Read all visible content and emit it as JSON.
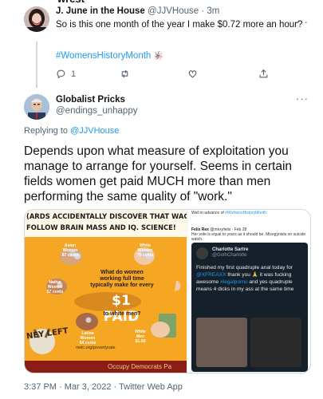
{
  "fragment_top": "wrest",
  "tweet1": {
    "name": "J. June in the House",
    "handle_time": "@JJVHouse · 3m",
    "text": "So is this one month of the year I make $0.72 more an hour?",
    "hashtag": "#WomensHistoryMonth",
    "hashtag_emoji": "🪅",
    "reply_count": "1",
    "more": "···"
  },
  "tweet2": {
    "name": "Globalist Pricks",
    "handle": "@endings_unhappy",
    "replying_prefix": "Replying to ",
    "replying_to": "@JJVHouse",
    "text": "Depends upon what measure of exploitation you manage to arrange for yourself.  Seems in certain fields women get paid MUCH more than men performing the same quality of \"work.\"",
    "more": "···",
    "timestamp": "3:37 PM · Mar 3, 2022 · Twitter Web App"
  },
  "poster": {
    "headline1": "(ARDS ACCIDENTALLY DISCOVER THAT WAG",
    "headline2": " FOLLOW BRAIN MASS AND IQ. SCIENCE!",
    "asian": "Asian\nWomen\n87 cents",
    "white_women": "White\nWomen\n79 cents",
    "native": "Native\nWomen\n57 cents",
    "latina": "Latina\nWomen\n54 cents",
    "white_men": "White\nMen\n$1.00",
    "tagline": "What do women working full time typically make for every",
    "paid": "$1 PAID",
    "to_white_men": "to white men?",
    "logo": "NEY LEFT",
    "url": "nwlc.org/povertyrate",
    "bottom": "Occupy Democrats Pa"
  },
  "screenshot": {
    "top_text": "Well in advance of",
    "top_hashtag": "#WomensHistoryMonth",
    "felix_name": "Felix Rex",
    "felix_meta": "@mexyfelix · Feb 28",
    "felix_text": "Her vote is equal to yours as it should be. Misogynists on suicide watch.",
    "dark_name": "Charlotte Sartre",
    "dark_handle": "@GothCharlotte",
    "dark_text_1": "Finished my first quadruple anal today for ",
    "dark_link_1": "@XFREAXX",
    "dark_text_2": " thank you 🙏 it was fucking awesome ",
    "dark_link_2": "#legalporno",
    "dark_text_3": " and yes quadruple means 4 dicks in my ass at the same time"
  }
}
